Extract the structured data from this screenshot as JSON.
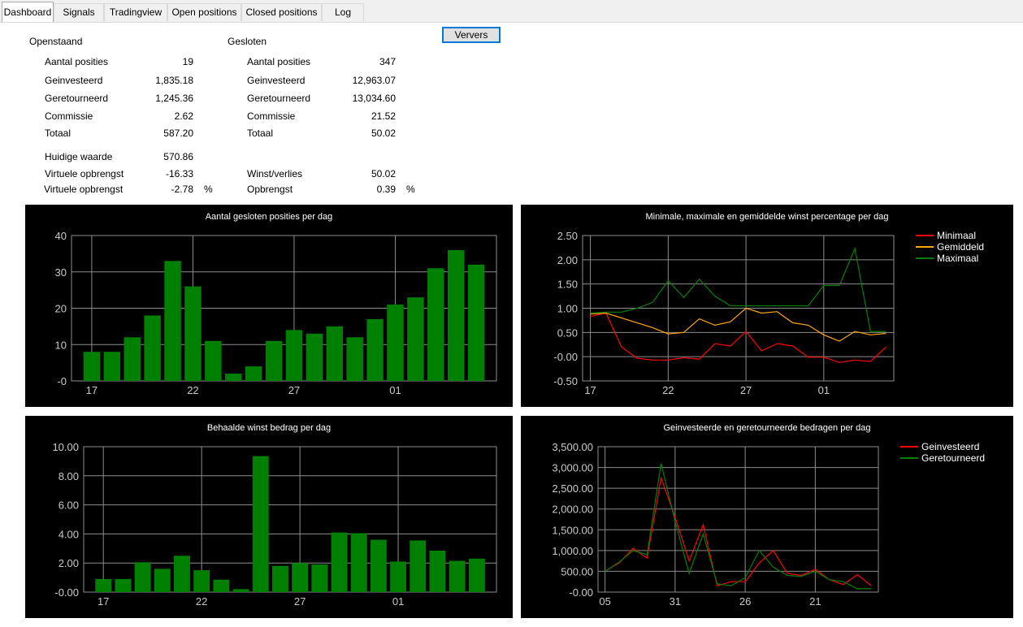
{
  "tabs": [
    {
      "label": "Dashboard",
      "active": true
    },
    {
      "label": "Signals",
      "active": false
    },
    {
      "label": "Tradingview",
      "active": false
    },
    {
      "label": "Open positions",
      "active": false
    },
    {
      "label": "Closed positions",
      "active": false
    },
    {
      "label": "Log",
      "active": false
    }
  ],
  "refresh_label": "Ververs",
  "open": {
    "heading": "Openstaand",
    "rows": [
      {
        "label": "Aantal posities",
        "value": "19"
      },
      {
        "label": "Geinvesteerd",
        "value": "1,835.18"
      },
      {
        "label": "Geretourneerd",
        "value": "1,245.36"
      },
      {
        "label": "Commissie",
        "value": "2.62"
      },
      {
        "label": "Totaal",
        "value": "587.20"
      }
    ],
    "current_value_label": "Huidige waarde",
    "current_value": "570.86",
    "virtual_label": "Virtuele opbrengst",
    "virtual_value": "-16.33",
    "virtual_pct_label": "Virtuele opbrengst",
    "virtual_pct_value": "-2.78",
    "pct_unit": "%"
  },
  "closed": {
    "heading": "Gesloten",
    "rows": [
      {
        "label": "Aantal posities",
        "value": "347"
      },
      {
        "label": "Geinvesteerd",
        "value": "12,963.07"
      },
      {
        "label": "Geretourneerd",
        "value": "13,034.60"
      },
      {
        "label": "Commissie",
        "value": "21.52"
      },
      {
        "label": "Totaal",
        "value": "50.02"
      }
    ],
    "winloss_label": "Winst/verlies",
    "winloss_value": "50.02",
    "yield_label": "Opbrengst",
    "yield_value": "0.39",
    "pct_unit": "%"
  },
  "chart_data": [
    {
      "type": "bar",
      "title": "Aantal gesloten posities per dag",
      "ylim": [
        0,
        40
      ],
      "yticks": [
        0,
        10,
        20,
        30,
        40
      ],
      "ytick_labels": [
        "-0",
        "10",
        "20",
        "30",
        "40"
      ],
      "xtick_labels": [
        "17",
        "22",
        "27",
        "01"
      ],
      "xtick_index": [
        0,
        5,
        10,
        15
      ],
      "values": [
        8,
        8,
        12,
        18,
        33,
        26,
        11,
        2,
        4,
        11,
        14,
        13,
        15,
        12,
        17,
        21,
        23,
        31,
        36,
        32
      ],
      "grid": true,
      "colors": {
        "bar": "#008000"
      }
    },
    {
      "type": "line",
      "title": "Minimale, maximale en gemiddelde winst percentage per dag",
      "ylim": [
        -0.5,
        2.5
      ],
      "yticks": [
        -0.5,
        0,
        0.5,
        1,
        1.5,
        2,
        2.5
      ],
      "ytick_labels": [
        "-0.50",
        "-0.00",
        "0.50",
        "1.00",
        "1.50",
        "2.00",
        "2.50"
      ],
      "xtick_labels": [
        "17",
        "22",
        "27",
        "01"
      ],
      "xtick_index": [
        0,
        5,
        10,
        15
      ],
      "grid": true,
      "legend_position": "top-right",
      "series": [
        {
          "name": "Minimaal",
          "color": "#ff0000",
          "values": [
            0.83,
            0.9,
            0.2,
            -0.03,
            -0.07,
            -0.07,
            -0.02,
            -0.05,
            0.27,
            0.22,
            0.52,
            0.12,
            0.27,
            0.22,
            -0.01,
            -0.01,
            -0.12,
            -0.07,
            -0.1,
            0.2
          ]
        },
        {
          "name": "Gemiddeld",
          "color": "#ffa500",
          "values": [
            0.88,
            0.9,
            0.8,
            0.7,
            0.6,
            0.47,
            0.5,
            0.78,
            0.65,
            0.72,
            1.0,
            0.9,
            0.93,
            0.7,
            0.65,
            0.45,
            0.32,
            0.52,
            0.45,
            0.48
          ]
        },
        {
          "name": "Maximaal",
          "color": "#008000",
          "values": [
            0.9,
            0.92,
            0.92,
            1.0,
            1.12,
            1.57,
            1.22,
            1.6,
            1.25,
            1.05,
            1.05,
            1.05,
            1.05,
            1.05,
            1.05,
            1.47,
            1.47,
            2.23,
            0.52,
            0.52
          ]
        }
      ]
    },
    {
      "type": "bar",
      "title": "Behaalde winst bedrag per dag",
      "ylim": [
        0,
        10
      ],
      "yticks": [
        0,
        2,
        4,
        6,
        8,
        10
      ],
      "ytick_labels": [
        "-0.00",
        "2.00",
        "4.00",
        "6.00",
        "8.00",
        "10.00"
      ],
      "xtick_labels": [
        "17",
        "22",
        "27",
        "01"
      ],
      "xtick_index": [
        0,
        5,
        10,
        15
      ],
      "values": [
        0.9,
        0.9,
        2.05,
        1.6,
        2.5,
        1.5,
        0.85,
        0.2,
        9.35,
        1.8,
        2.0,
        1.9,
        4.1,
        4.05,
        3.6,
        2.1,
        3.55,
        2.85,
        2.15,
        2.3
      ],
      "grid": true,
      "colors": {
        "bar": "#008000"
      }
    },
    {
      "type": "line",
      "title": "Geinvesteerde en geretourneerde bedragen per dag",
      "ylim": [
        0,
        3500
      ],
      "yticks": [
        0,
        500,
        1000,
        1500,
        2000,
        2500,
        3000,
        3500
      ],
      "ytick_labels": [
        "-0.00",
        "500.00",
        "1,000.00",
        "1,500.00",
        "2,000.00",
        "2,500.00",
        "3,000.00",
        "3,500.00"
      ],
      "xtick_labels": [
        "05",
        "31",
        "26",
        "21"
      ],
      "xtick_index": [
        0,
        5,
        10,
        15
      ],
      "grid": true,
      "legend_position": "top-right",
      "series": [
        {
          "name": "Geinvesteerd",
          "color": "#ff0000",
          "values": [
            500,
            700,
            1050,
            820,
            2750,
            1800,
            750,
            1620,
            150,
            250,
            250,
            700,
            1000,
            450,
            400,
            550,
            300,
            180,
            420,
            150
          ]
        },
        {
          "name": "Geretourneerd",
          "color": "#008000",
          "values": [
            500,
            720,
            1000,
            900,
            3100,
            1700,
            450,
            1400,
            200,
            150,
            350,
            1000,
            600,
            400,
            380,
            500,
            300,
            250,
            80,
            80
          ]
        }
      ]
    }
  ]
}
